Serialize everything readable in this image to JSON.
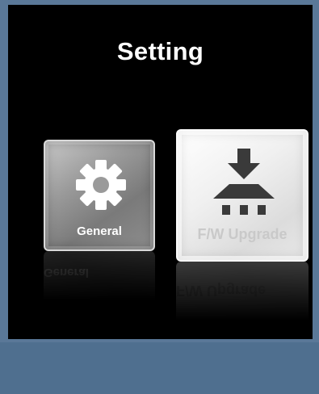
{
  "screen": {
    "title": "Setting"
  },
  "tiles": [
    {
      "label": "General",
      "icon": "gear-icon"
    },
    {
      "label": "F/W Upgrade",
      "icon": "download-upgrade-icon"
    }
  ],
  "colors": {
    "background": "#000000",
    "frame": "#5a7898",
    "title_text": "#ffffff",
    "general_tile": "#8e8e8e",
    "fw_tile": "#e8e8e8"
  }
}
